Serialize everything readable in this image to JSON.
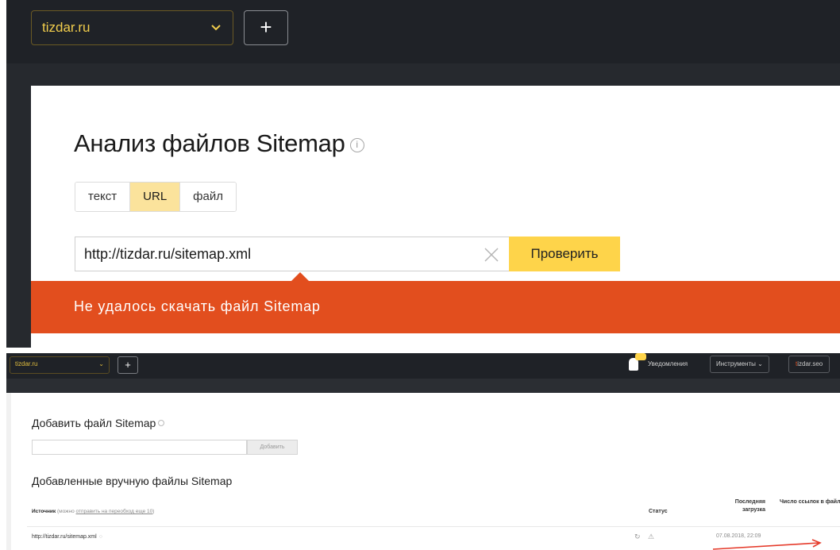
{
  "top": {
    "site": "tizdar.ru",
    "add_label": "+",
    "title": "Анализ файлов Sitemap",
    "info_glyph": "i",
    "modes": [
      "текст",
      "URL",
      "файл"
    ],
    "active_mode": "URL",
    "url_value": "http://tizdar.ru/sitemap.xml",
    "clear_glyph": "✕",
    "check_label": "Проверить",
    "error_message": "Не удалось скачать файл Sitemap"
  },
  "bottom": {
    "site": "tizdar.ru",
    "add_label": "+",
    "notifications": "Уведомления",
    "tools": "Инструменты ⌄",
    "user_first": "t",
    "user_rest": "izdar.seo",
    "add_sitemap_title": "Добавить файл Sitemap",
    "add_button": "Добавить",
    "added_title": "Добавленные вручную файлы Sitemap",
    "col_source": "Источник",
    "col_source_hint": "(можно",
    "col_source_link": "отправить на переобход еще 10",
    "col_source_end": ")",
    "col_status": "Статус",
    "col_last": "Последняя загрузка",
    "col_count": "Число ссылок в файле",
    "row": {
      "url": "http://tizdar.ru/sitemap.xml",
      "date": "07.08.2018, 22:09"
    }
  },
  "colors": {
    "accent_yellow": "#fed44a",
    "error_orange": "#e24e1e",
    "header_dark": "#1f2227"
  }
}
